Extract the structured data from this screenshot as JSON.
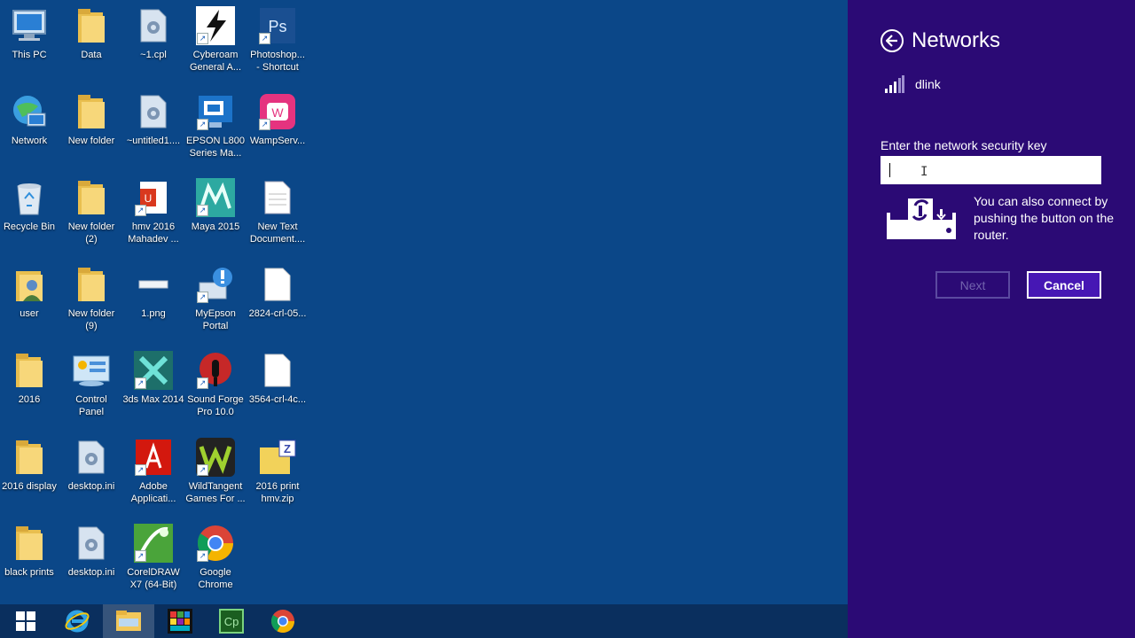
{
  "desktop": {
    "icons": [
      {
        "label": "This PC",
        "icon": "computer-icon"
      },
      {
        "label": "Data",
        "icon": "folder-icon"
      },
      {
        "label": "~1.cpl",
        "icon": "settings-file-icon"
      },
      {
        "label": "Cyberoam\nGeneral A...",
        "icon": "cyberoam-icon"
      },
      {
        "label": "Photoshop...\n- Shortcut",
        "icon": "photoshop-icon"
      },
      {
        "label": "Network",
        "icon": "network-icon"
      },
      {
        "label": "New folder",
        "icon": "folder-icon"
      },
      {
        "label": "~untitled1....",
        "icon": "settings-file-icon"
      },
      {
        "label": "EPSON L800\nSeries Ma...",
        "icon": "epson-icon"
      },
      {
        "label": "WampServ...",
        "icon": "wampserver-icon"
      },
      {
        "label": "Recycle Bin",
        "icon": "recycle-bin-icon"
      },
      {
        "label": "New folder\n(2)",
        "icon": "folder-icon"
      },
      {
        "label": "hmv 2016\nMahadev ...",
        "icon": "pdf-icon"
      },
      {
        "label": "Maya 2015",
        "icon": "maya-icon"
      },
      {
        "label": "New Text\nDocument....",
        "icon": "text-document-icon"
      },
      {
        "label": "user",
        "icon": "user-folder-icon"
      },
      {
        "label": "New folder\n(9)",
        "icon": "folder-icon"
      },
      {
        "label": "1.png",
        "icon": "image-file-icon"
      },
      {
        "label": "MyEpson\nPortal",
        "icon": "myepson-icon"
      },
      {
        "label": "2824-crl-05...",
        "icon": "blank-file-icon"
      },
      {
        "label": "2016",
        "icon": "folder-icon"
      },
      {
        "label": "Control\nPanel",
        "icon": "control-panel-icon"
      },
      {
        "label": "3ds Max 2014",
        "icon": "3dsmax-icon"
      },
      {
        "label": "Sound Forge\nPro 10.0",
        "icon": "sound-forge-icon"
      },
      {
        "label": "3564-crl-4c...",
        "icon": "blank-file-icon"
      },
      {
        "label": "2016 display",
        "icon": "folder-icon"
      },
      {
        "label": "desktop.ini",
        "icon": "settings-file-icon"
      },
      {
        "label": "Adobe\nApplicati...",
        "icon": "adobe-icon"
      },
      {
        "label": "WildTangent\nGames For ...",
        "icon": "wildtangent-icon"
      },
      {
        "label": "2016 print\nhmv.zip",
        "icon": "zip-folder-icon"
      },
      {
        "label": "black prints",
        "icon": "folder-icon"
      },
      {
        "label": "desktop.ini",
        "icon": "settings-file-icon"
      },
      {
        "label": "CorelDRAW\nX7 (64-Bit)",
        "icon": "coreldraw-icon"
      },
      {
        "label": "Google\nChrome",
        "icon": "chrome-icon"
      }
    ]
  },
  "taskbar": {
    "items": [
      "start-icon",
      "internet-explorer-icon",
      "file-explorer-icon",
      "media-app-icon",
      "captivate-icon",
      "chrome-icon"
    ]
  },
  "networks": {
    "title": "Networks",
    "network_name": "dlink",
    "key_label": "Enter the network security key",
    "key_value": "",
    "wps_text": "You can also connect by pushing the button on the router.",
    "next_label": "Next",
    "cancel_label": "Cancel"
  },
  "colors": {
    "desktop_bg": "#0b4788",
    "charm_bg": "#2b0a75",
    "taskbar_bg": "#0a2f5e",
    "cancel_bg": "#4617b4"
  }
}
